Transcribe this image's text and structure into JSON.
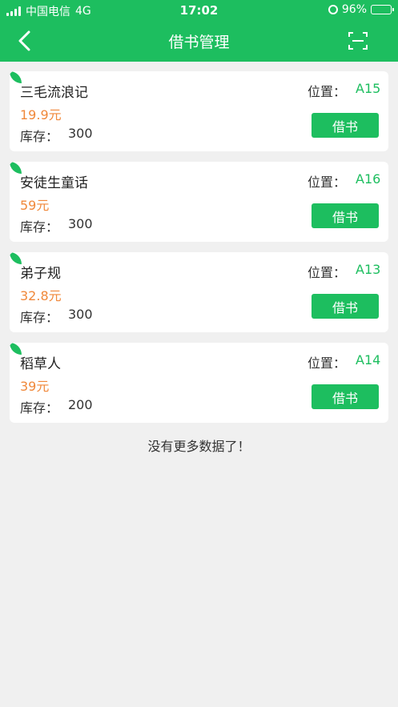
{
  "status_bar": {
    "carrier": "中国电信",
    "network": "4G",
    "time": "17:02",
    "battery": "96%",
    "battery_level": 0.96
  },
  "nav": {
    "title": "借书管理",
    "back_icon": "chevron-left-icon",
    "scan_icon": "scan-icon"
  },
  "labels": {
    "location": "位置：",
    "stock": "库存：",
    "borrow": "借书"
  },
  "books": [
    {
      "name": "三毛流浪记",
      "price": "19.9元",
      "stock": "300",
      "location": "A15"
    },
    {
      "name": "安徒生童话",
      "price": "59元",
      "stock": "300",
      "location": "A16"
    },
    {
      "name": "弟子规",
      "price": "32.8元",
      "stock": "300",
      "location": "A13"
    },
    {
      "name": "稻草人",
      "price": "39元",
      "stock": "200",
      "location": "A14"
    }
  ],
  "footer": {
    "no_more": "没有更多数据了！"
  },
  "colors": {
    "primary": "#1dbe5f",
    "price": "#f0883a",
    "background": "#f0f0f0"
  }
}
